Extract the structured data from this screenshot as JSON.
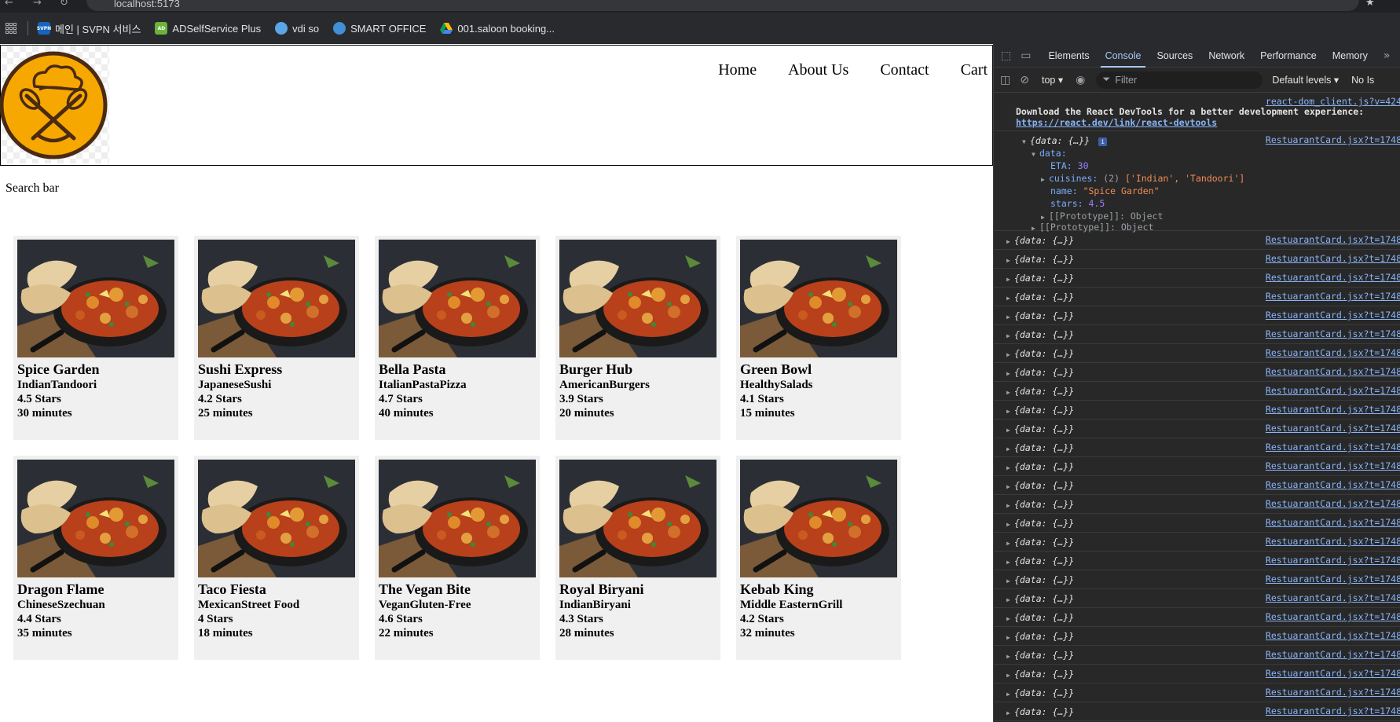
{
  "browser": {
    "url": "localhost:5173",
    "bookmarks": [
      {
        "label": "메인 | SVPN 서비스",
        "icon": "svpn-icon",
        "fav_text": "SVPN"
      },
      {
        "label": "ADSelfService Plus",
        "icon": "adselfservice-icon",
        "fav_text": "AD"
      },
      {
        "label": "vdi so",
        "icon": "vdi-icon",
        "fav_text": ""
      },
      {
        "label": "SMART OFFICE",
        "icon": "smart-office-icon",
        "fav_text": ""
      },
      {
        "label": "001.saloon booking...",
        "icon": "google-drive-icon",
        "fav_text": ""
      }
    ]
  },
  "header": {
    "logo": "chef-hat-whisk-logo",
    "nav": [
      {
        "label": "Home"
      },
      {
        "label": "About Us"
      },
      {
        "label": "Contact"
      },
      {
        "label": "Cart"
      }
    ]
  },
  "search": {
    "label": "Search bar"
  },
  "restaurants": [
    {
      "name": "Spice Garden",
      "cuisines": "IndianTandoori",
      "stars": "4.5 Stars",
      "eta": "30 minutes"
    },
    {
      "name": "Sushi Express",
      "cuisines": "JapaneseSushi",
      "stars": "4.2 Stars",
      "eta": "25 minutes"
    },
    {
      "name": "Bella Pasta",
      "cuisines": "ItalianPastaPizza",
      "stars": "4.7 Stars",
      "eta": "40 minutes"
    },
    {
      "name": "Burger Hub",
      "cuisines": "AmericanBurgers",
      "stars": "3.9 Stars",
      "eta": "20 minutes"
    },
    {
      "name": "Green Bowl",
      "cuisines": "HealthySalads",
      "stars": "4.1 Stars",
      "eta": "15 minutes"
    },
    {
      "name": "Dragon Flame",
      "cuisines": "ChineseSzechuan",
      "stars": "4.4 Stars",
      "eta": "35 minutes"
    },
    {
      "name": "Taco Fiesta",
      "cuisines": "MexicanStreet Food",
      "stars": "4 Stars",
      "eta": "18 minutes"
    },
    {
      "name": "The Vegan Bite",
      "cuisines": "VeganGluten-Free",
      "stars": "4.6 Stars",
      "eta": "22 minutes"
    },
    {
      "name": "Royal Biryani",
      "cuisines": "IndianBiryani",
      "stars": "4.3 Stars",
      "eta": "28 minutes"
    },
    {
      "name": "Kebab King",
      "cuisines": "Middle EasternGrill",
      "stars": "4.2 Stars",
      "eta": "32 minutes"
    }
  ],
  "devtools": {
    "tabs": [
      "Elements",
      "Console",
      "Sources",
      "Network",
      "Performance",
      "Memory"
    ],
    "active_tab": "Console",
    "more_tabs": "»",
    "context": "top",
    "filter_placeholder": "Filter",
    "levels": "Default levels",
    "issues": "No Is",
    "console": {
      "devtools_src": "react-dom_client.js?v=424",
      "devtools_msg": "Download the React DevTools for a better development experience:",
      "devtools_link": "https://react.dev/link/react-devtools",
      "log_src": "RestuarantCard.jsx?t=1748",
      "expanded": {
        "summary": "{data: {…}}",
        "info_badge": "i",
        "data_key": "data:",
        "eta_key": "ETA:",
        "eta_val": "30",
        "cuisines_key": "cuisines:",
        "cuisines_len": "(2)",
        "cuisines_val": "['Indian', 'Tandoori']",
        "name_key": "name:",
        "name_val": "\"Spice Garden\"",
        "stars_key": "stars:",
        "stars_val": "4.5",
        "proto_inner": "[[Prototype]]: Object",
        "proto_outer": "[[Prototype]]: Object"
      },
      "collapsed_text": "{data: {…}}",
      "collapsed_count": 27
    }
  }
}
